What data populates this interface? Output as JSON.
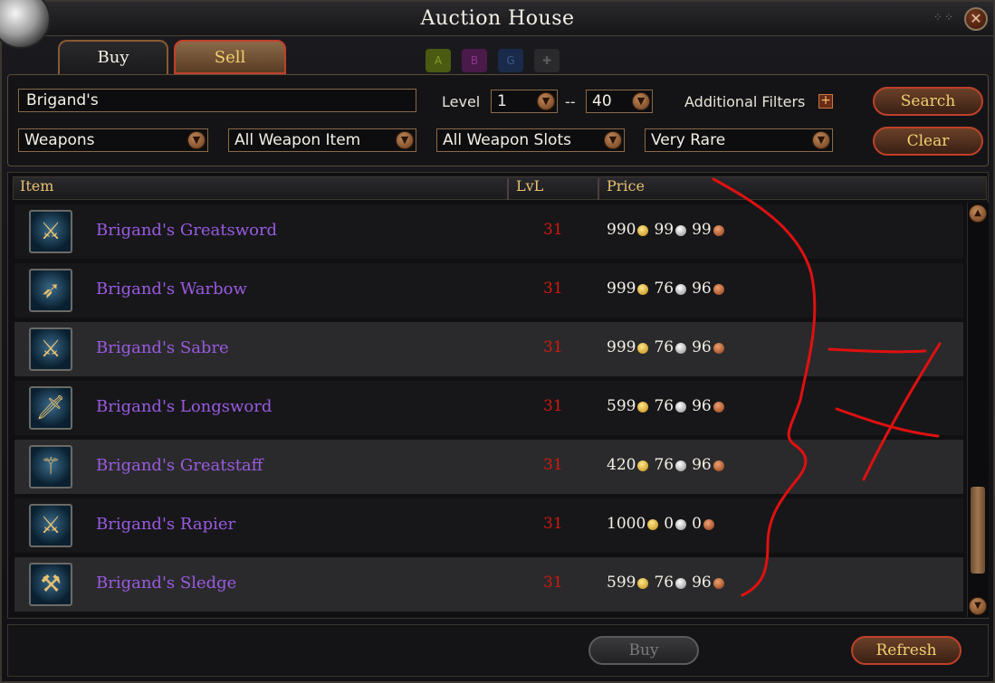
{
  "window": {
    "title": "Auction House"
  },
  "tabs": [
    {
      "label": "Buy",
      "active": true
    },
    {
      "label": "Sell",
      "active": false
    }
  ],
  "filters": {
    "search_value": "Brigand's",
    "level_label": "Level",
    "level_min": "1",
    "level_separator": "--",
    "level_max": "40",
    "additional_filters_label": "Additional Filters",
    "category": "Weapons",
    "item_type": "All Weapon Item",
    "slot": "All Weapon Slots",
    "rarity": "Very Rare"
  },
  "buttons": {
    "search": "Search",
    "clear": "Clear",
    "buy": "Buy",
    "refresh": "Refresh"
  },
  "columns": {
    "item": "Item",
    "level": "LvL",
    "price": "Price"
  },
  "items": [
    {
      "name": "Brigand's Greatsword",
      "level": "31",
      "gold": "990",
      "silver": "99",
      "copper": "99",
      "icon": "greatsword-icon"
    },
    {
      "name": "Brigand's Warbow",
      "level": "31",
      "gold": "999",
      "silver": "76",
      "copper": "96",
      "icon": "warbow-icon"
    },
    {
      "name": "Brigand's Sabre",
      "level": "31",
      "gold": "999",
      "silver": "76",
      "copper": "96",
      "icon": "sabre-icon"
    },
    {
      "name": "Brigand's Longsword",
      "level": "31",
      "gold": "599",
      "silver": "76",
      "copper": "96",
      "icon": "longsword-icon"
    },
    {
      "name": "Brigand's Greatstaff",
      "level": "31",
      "gold": "420",
      "silver": "76",
      "copper": "96",
      "icon": "greatstaff-icon"
    },
    {
      "name": "Brigand's Rapier",
      "level": "31",
      "gold": "1000",
      "silver": "0",
      "copper": "0",
      "icon": "rapier-icon"
    },
    {
      "name": "Brigand's Sledge",
      "level": "31",
      "gold": "599",
      "silver": "76",
      "copper": "96",
      "icon": "sledge-icon"
    }
  ],
  "colors": {
    "item_name": "#9a5ae0",
    "level_text": "#d01a10",
    "header_text": "#e8c070",
    "button_text": "#f2d070",
    "annotation_ink": "#e01010"
  }
}
